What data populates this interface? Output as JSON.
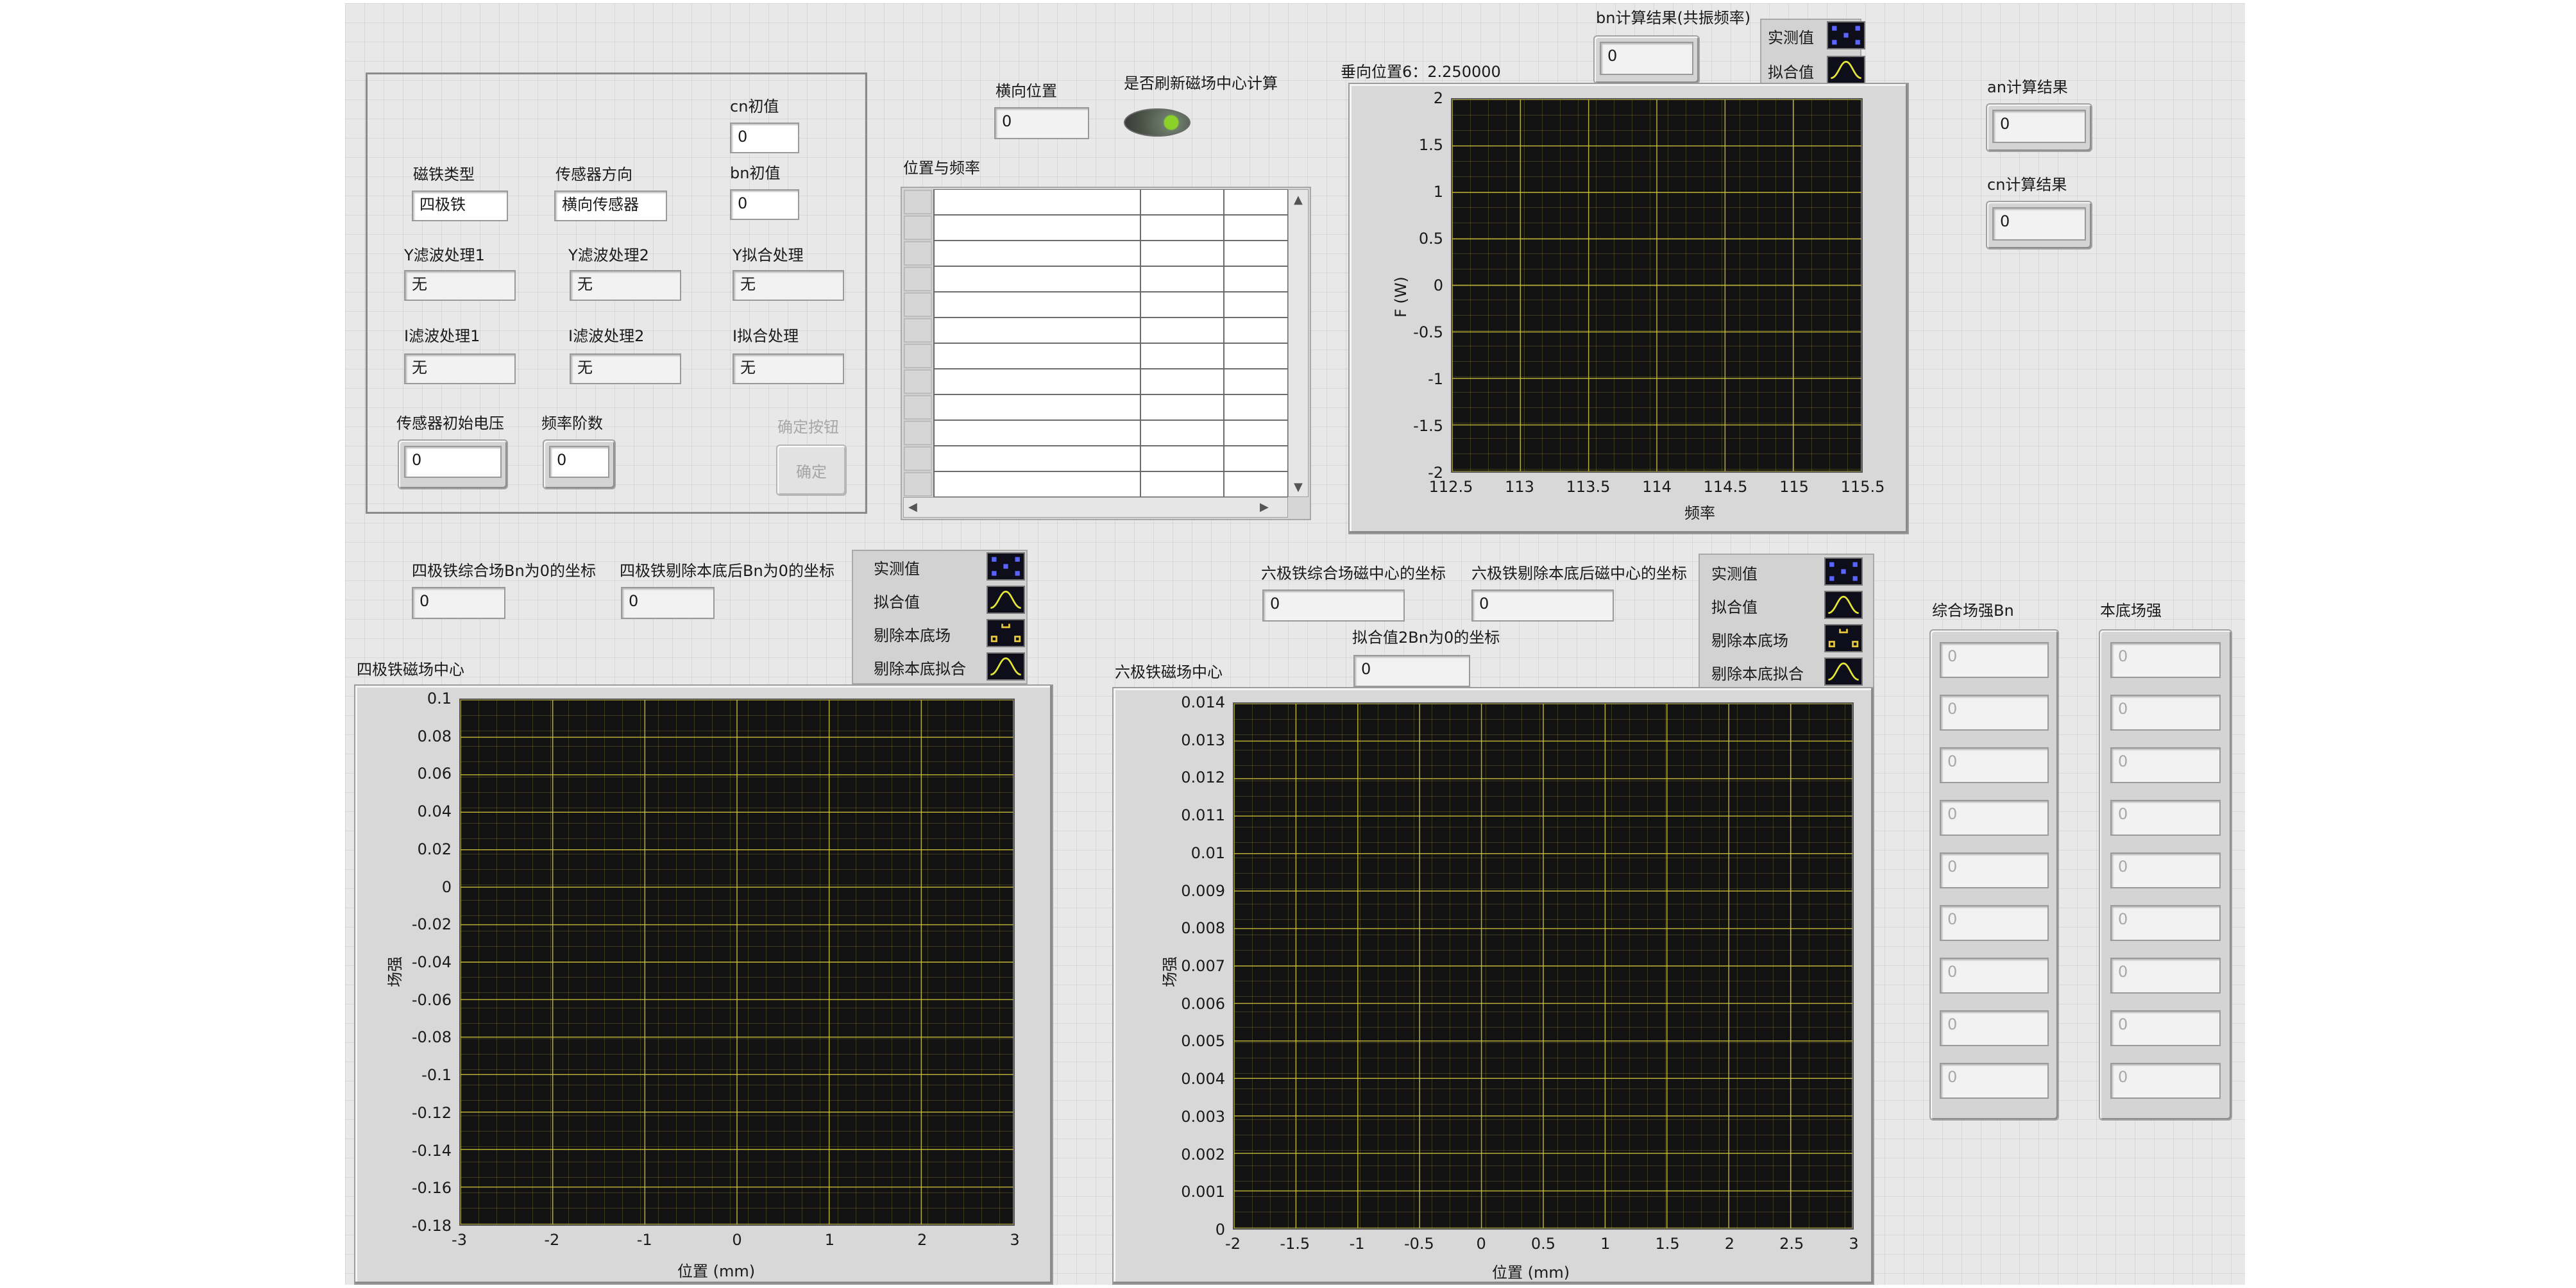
{
  "config_group": {
    "cn_init_label": "cn初值",
    "cn_init_value": "0",
    "bn_init_label": "bn初值",
    "bn_init_value": "0",
    "magnet_type_label": "磁铁类型",
    "magnet_type_value": "四极铁",
    "sensor_dir_label": "传感器方向",
    "sensor_dir_value": "横向传感器",
    "y_filter1_label": "Y滤波处理1",
    "y_filter1_value": "无",
    "y_filter2_label": "Y滤波处理2",
    "y_filter2_value": "无",
    "y_fit_label": "Y拟合处理",
    "y_fit_value": "无",
    "i_filter1_label": "I滤波处理1",
    "i_filter1_value": "无",
    "i_filter2_label": "I滤波处理2",
    "i_filter2_value": "无",
    "i_fit_label": "I拟合处理",
    "i_fit_value": "无",
    "sensor_voltage_label": "传感器初始电压",
    "sensor_voltage_value": "0",
    "freq_order_label": "频率阶数",
    "freq_order_value": "0",
    "confirm_caption": "确定按钮",
    "confirm_label": "确定"
  },
  "top_middle": {
    "lateral_pos_label": "横向位置",
    "lateral_pos_value": "0",
    "refresh_label": "是否刷新磁场中心计算",
    "table_title": "位置与频率"
  },
  "freq_chart": {
    "vertical_pos_label": "垂向位置6：2.250000",
    "bn_result_label": "bn计算结果(共振频率)",
    "bn_result_value": "0",
    "legend": [
      "实测值",
      "拟合值"
    ]
  },
  "right_results": {
    "an_label": "an计算结果",
    "an_value": "0",
    "cn_label": "cn计算结果",
    "cn_value": "0"
  },
  "quad": {
    "bn_zero_label": "四极铁综合场Bn为0的坐标",
    "bn_zero_value": "0",
    "bn_zero_bg_label": "四极铁剔除本底后Bn为0的坐标",
    "bn_zero_bg_value": "0",
    "legend": [
      "实测值",
      "拟合值",
      "剔除本底场",
      "剔除本底拟合"
    ]
  },
  "hexa": {
    "center_label": "六极铁综合场磁中心的坐标",
    "center_value": "0",
    "center_bg_label": "六极铁剔除本底后磁中心的坐标",
    "center_bg_value": "0",
    "fit2_label": "拟合值2Bn为0的坐标",
    "fit2_value": "0",
    "legend": [
      "实测值",
      "拟合值",
      "剔除本底场",
      "剔除本底拟合"
    ]
  },
  "arrays": {
    "combined_title": "综合场强Bn",
    "combined_values": [
      "0",
      "0",
      "0",
      "0",
      "0",
      "0",
      "0",
      "0",
      "0"
    ],
    "background_title": "本底场强",
    "background_values": [
      "0",
      "0",
      "0",
      "0",
      "0",
      "0",
      "0",
      "0",
      "0"
    ]
  },
  "chart_data": [
    {
      "type": "line",
      "xlabel": "频率",
      "ylabel": "F (W)",
      "xlim": [
        112.5,
        115.5
      ],
      "ylim": [
        -2,
        2
      ],
      "x_ticks": [
        "112.5",
        "113",
        "113.5",
        "114",
        "114.5",
        "115",
        "115.5"
      ],
      "y_ticks": [
        "2",
        "1.5",
        "1",
        "0.5",
        "0",
        "-0.5",
        "-1",
        "-1.5",
        "-2"
      ],
      "grid": true,
      "series": [
        {
          "name": "实测值",
          "x": [],
          "y": []
        },
        {
          "name": "拟合值",
          "x": [],
          "y": []
        }
      ]
    },
    {
      "type": "line",
      "title": "四极铁磁场中心",
      "xlabel": "位置 (mm)",
      "ylabel": "场强",
      "xlim": [
        -3,
        3
      ],
      "ylim": [
        -0.18,
        0.1
      ],
      "x_ticks": [
        "-3",
        "-2",
        "-1",
        "0",
        "1",
        "2",
        "3"
      ],
      "y_ticks": [
        "0.1",
        "0.08",
        "0.06",
        "0.04",
        "0.02",
        "0",
        "-0.02",
        "-0.04",
        "-0.06",
        "-0.08",
        "-0.1",
        "-0.12",
        "-0.14",
        "-0.16",
        "-0.18"
      ],
      "grid": true,
      "series": [
        {
          "name": "实测值",
          "x": [],
          "y": []
        },
        {
          "name": "拟合值",
          "x": [],
          "y": []
        },
        {
          "name": "剔除本底场",
          "x": [],
          "y": []
        },
        {
          "name": "剔除本底拟合",
          "x": [],
          "y": []
        }
      ]
    },
    {
      "type": "line",
      "title": "六极铁磁场中心",
      "xlabel": "位置 (mm)",
      "ylabel": "场强",
      "xlim": [
        -2,
        3
      ],
      "ylim": [
        0,
        0.014
      ],
      "x_ticks": [
        "-2",
        "-1.5",
        "-1",
        "-0.5",
        "0",
        "0.5",
        "1",
        "1.5",
        "2",
        "2.5",
        "3"
      ],
      "y_ticks": [
        "0.014",
        "0.013",
        "0.012",
        "0.011",
        "0.01",
        "0.009",
        "0.008",
        "0.007",
        "0.006",
        "0.005",
        "0.004",
        "0.003",
        "0.002",
        "0.001",
        "0"
      ],
      "grid": true,
      "series": [
        {
          "name": "实测值",
          "x": [],
          "y": []
        },
        {
          "name": "拟合值",
          "x": [],
          "y": []
        },
        {
          "name": "剔除本底场",
          "x": [],
          "y": []
        },
        {
          "name": "剔除本底拟合",
          "x": [],
          "y": []
        }
      ]
    }
  ]
}
